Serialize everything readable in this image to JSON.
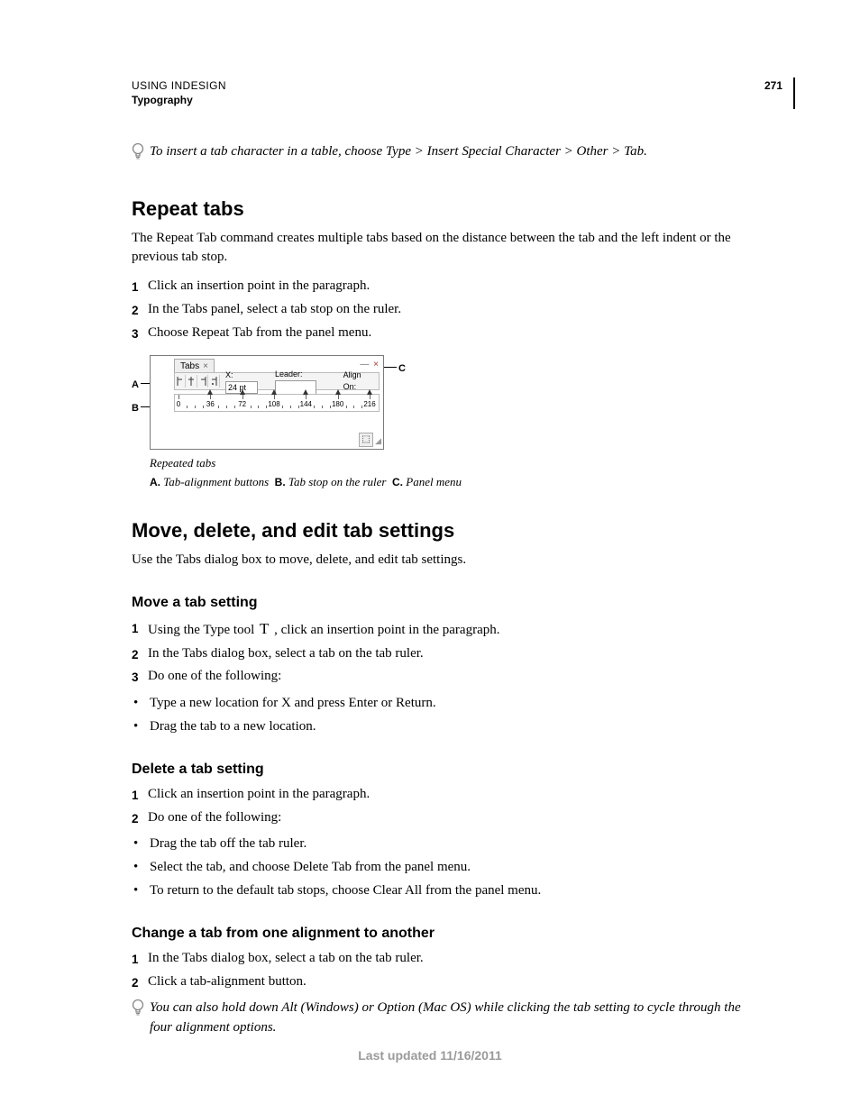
{
  "header": {
    "product": "USING INDESIGN",
    "section": "Typography",
    "page": "271"
  },
  "tip1": "To insert a tab character in a table, choose Type > Insert Special Character > Other > Tab.",
  "h1": "Repeat tabs",
  "p1": "The Repeat Tab command creates multiple tabs based on the distance between the tab and the left indent or the previous tab stop.",
  "steps1": [
    "Click an insertion point in the paragraph.",
    "In the Tabs panel, select a tab stop on the ruler.",
    "Choose Repeat Tab from the panel menu."
  ],
  "tabsPanel": {
    "title": "Tabs",
    "xLabel": "X:",
    "xValue": "24 pt",
    "leaderLabel": "Leader:",
    "alignLabel": "Align On:",
    "rulerMarks": [
      "0",
      "36",
      "72",
      "108",
      "144",
      "180",
      "216"
    ]
  },
  "callouts": {
    "A": "A",
    "B": "B",
    "C": "C"
  },
  "figCaption": "Repeated tabs",
  "figLegend": [
    {
      "k": "A.",
      "v": "Tab-alignment buttons"
    },
    {
      "k": "B.",
      "v": "Tab stop on the ruler"
    },
    {
      "k": "C.",
      "v": "Panel menu"
    }
  ],
  "h2": "Move, delete, and edit tab settings",
  "p2": "Use the Tabs dialog box to move, delete, and edit tab settings.",
  "h3a": "Move a tab setting",
  "steps3a": [
    {
      "pre": "Using the Type tool ",
      "post": " , click an insertion point in the paragraph."
    },
    {
      "plain": "In the Tabs dialog box, select a tab on the tab ruler."
    },
    {
      "plain": "Do one of the following:"
    }
  ],
  "bul3a": [
    "Type a new location for X and press Enter or Return.",
    "Drag the tab to a new location."
  ],
  "h3b": "Delete a tab setting",
  "steps3b": [
    "Click an insertion point in the paragraph.",
    "Do one of the following:"
  ],
  "bul3b": [
    "Drag the tab off the tab ruler.",
    "Select the tab, and choose Delete Tab from the panel menu.",
    "To return to the default tab stops, choose Clear All from the panel menu."
  ],
  "h3c": "Change a tab from one alignment to another",
  "steps3c": [
    "In the Tabs dialog box, select a tab on the tab ruler.",
    "Click a tab-alignment button."
  ],
  "tip2": "You can also hold down Alt (Windows) or Option (Mac OS) while clicking the tab setting to cycle through the four alignment options.",
  "footer": "Last updated 11/16/2011"
}
